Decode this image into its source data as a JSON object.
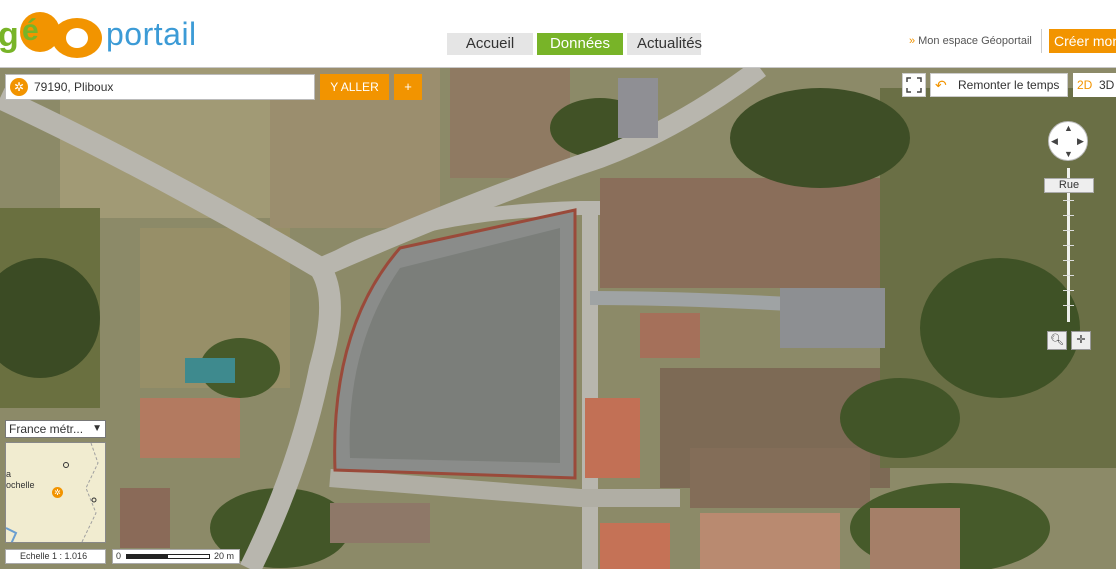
{
  "header": {
    "logo": "géoportail",
    "nav_tabs": [
      {
        "label": "Accueil",
        "active": false
      },
      {
        "label": "Données",
        "active": true
      },
      {
        "label": "Actualités",
        "active": false
      }
    ],
    "espace_link": "Mon espace Géoportail",
    "create_button": "Créer mon"
  },
  "search": {
    "value": "79190, Pliboux",
    "go_label": "Y ALLER",
    "plus_label": "+"
  },
  "tools": {
    "remonter_label": "Remonter le temps",
    "mode_2d": "2D",
    "mode_3d": "3D"
  },
  "zoom": {
    "level_label": "Rue"
  },
  "minimap": {
    "projection": "France métr...",
    "cities": [
      "a",
      "ochelle"
    ]
  },
  "scale": {
    "echelle_label": "Echelle 1 :",
    "echelle_value": "1.016",
    "start": "0",
    "distance": "20 m"
  },
  "colors": {
    "accent_orange": "#f29400",
    "accent_green": "#78b428",
    "logo_blue": "#3c9bd6"
  }
}
